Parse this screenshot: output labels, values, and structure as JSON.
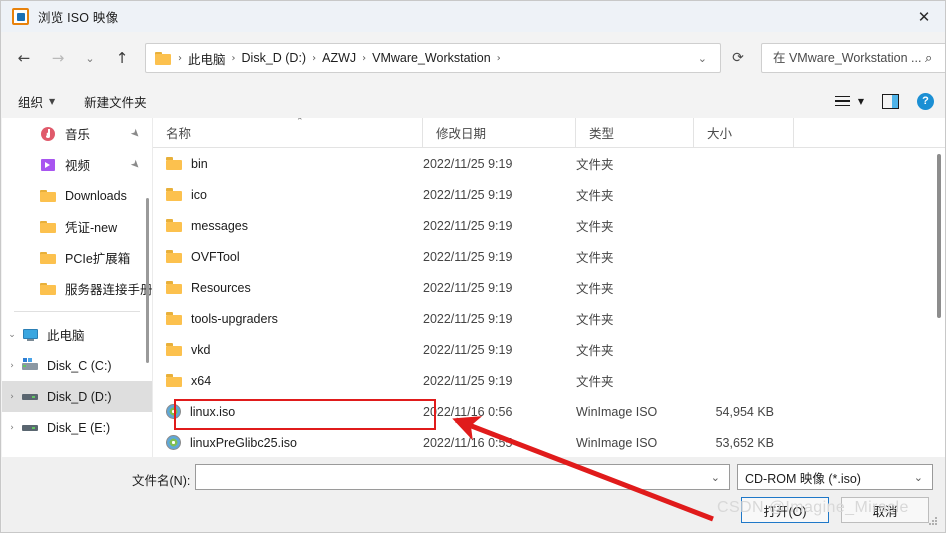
{
  "titlebar": {
    "title": "浏览 ISO 映像",
    "icon": "vmware-iso-icon",
    "close_label": "✕"
  },
  "navbar": {
    "back": "←",
    "forward": "→",
    "recent": "⌄",
    "up": "↑",
    "refresh": "⟳",
    "address_chevron": "⌄",
    "folder_icon": "folder-icon",
    "breadcrumbs": [
      "此电脑",
      "Disk_D (D:)",
      "AZWJ",
      "VMware_Workstation"
    ],
    "separator": "›"
  },
  "search": {
    "placeholder": "在 VMware_Workstation ...",
    "value": "",
    "icon": "⌕"
  },
  "commandbar": {
    "organize": "组织",
    "organize_caret": "▼",
    "new_folder": "新建文件夹",
    "view_caret": "▼",
    "help_glyph": "?"
  },
  "sidebar": {
    "items": [
      {
        "label": "音乐",
        "icon": "music-icon",
        "pinned": true,
        "indent": 1,
        "expander": "",
        "selected": false
      },
      {
        "label": "视频",
        "icon": "video-icon",
        "pinned": true,
        "indent": 1,
        "expander": "",
        "selected": false
      },
      {
        "label": "Downloads",
        "icon": "folder-icon",
        "pinned": false,
        "indent": 1,
        "expander": "",
        "selected": false
      },
      {
        "label": "凭证-new",
        "icon": "folder-icon",
        "pinned": false,
        "indent": 1,
        "expander": "",
        "selected": false
      },
      {
        "label": "PCIe扩展箱",
        "icon": "folder-icon",
        "pinned": false,
        "indent": 1,
        "expander": "",
        "selected": false
      },
      {
        "label": "服务器连接手册",
        "icon": "folder-icon",
        "pinned": false,
        "indent": 1,
        "expander": "",
        "selected": false
      },
      {
        "label": "此电脑",
        "icon": "computer-icon",
        "pinned": false,
        "indent": 0,
        "expander": "⌄",
        "selected": false
      },
      {
        "label": "Disk_C (C:)",
        "icon": "drive-system-icon",
        "pinned": false,
        "indent": 1,
        "expander": "›",
        "selected": false
      },
      {
        "label": "Disk_D (D:)",
        "icon": "drive-icon",
        "pinned": false,
        "indent": 1,
        "expander": "›",
        "selected": true
      },
      {
        "label": "Disk_E (E:)",
        "icon": "drive-icon",
        "pinned": false,
        "indent": 1,
        "expander": "›",
        "selected": false
      }
    ],
    "pin_glyph": "➤"
  },
  "filelist": {
    "columns": [
      "名称",
      "修改日期",
      "类型",
      "大小"
    ],
    "sort_caret": "⌃",
    "rows": [
      {
        "name": "bin",
        "date": "2022/11/25 9:19",
        "type": "文件夹",
        "size": "",
        "icon": "folder-icon"
      },
      {
        "name": "ico",
        "date": "2022/11/25 9:19",
        "type": "文件夹",
        "size": "",
        "icon": "folder-icon"
      },
      {
        "name": "messages",
        "date": "2022/11/25 9:19",
        "type": "文件夹",
        "size": "",
        "icon": "folder-icon"
      },
      {
        "name": "OVFTool",
        "date": "2022/11/25 9:19",
        "type": "文件夹",
        "size": "",
        "icon": "folder-icon"
      },
      {
        "name": "Resources",
        "date": "2022/11/25 9:19",
        "type": "文件夹",
        "size": "",
        "icon": "folder-icon"
      },
      {
        "name": "tools-upgraders",
        "date": "2022/11/25 9:19",
        "type": "文件夹",
        "size": "",
        "icon": "folder-icon"
      },
      {
        "name": "vkd",
        "date": "2022/11/25 9:19",
        "type": "文件夹",
        "size": "",
        "icon": "folder-icon"
      },
      {
        "name": "x64",
        "date": "2022/11/25 9:19",
        "type": "文件夹",
        "size": "",
        "icon": "folder-icon"
      },
      {
        "name": "linux.iso",
        "date": "2022/11/16 0:56",
        "type": "WinImage ISO",
        "size": "54,954 KB",
        "icon": "iso-icon"
      },
      {
        "name": "linuxPreGlibc25.iso",
        "date": "2022/11/16 0:55",
        "type": "WinImage ISO",
        "size": "53,652 KB",
        "icon": "iso-icon"
      }
    ]
  },
  "footer": {
    "filename_label": "文件名(N):",
    "filename_value": "",
    "filename_chevron": "⌄",
    "filetype_value": "CD-ROM 映像 (*.iso)",
    "filetype_chevron": "⌄",
    "open_label": "打开(O)",
    "cancel_label": "取消"
  },
  "annotation": {
    "color": "#e01b1b",
    "highlight_target": "linux.iso",
    "watermark": "CSDN @Imagine_Miracle"
  }
}
